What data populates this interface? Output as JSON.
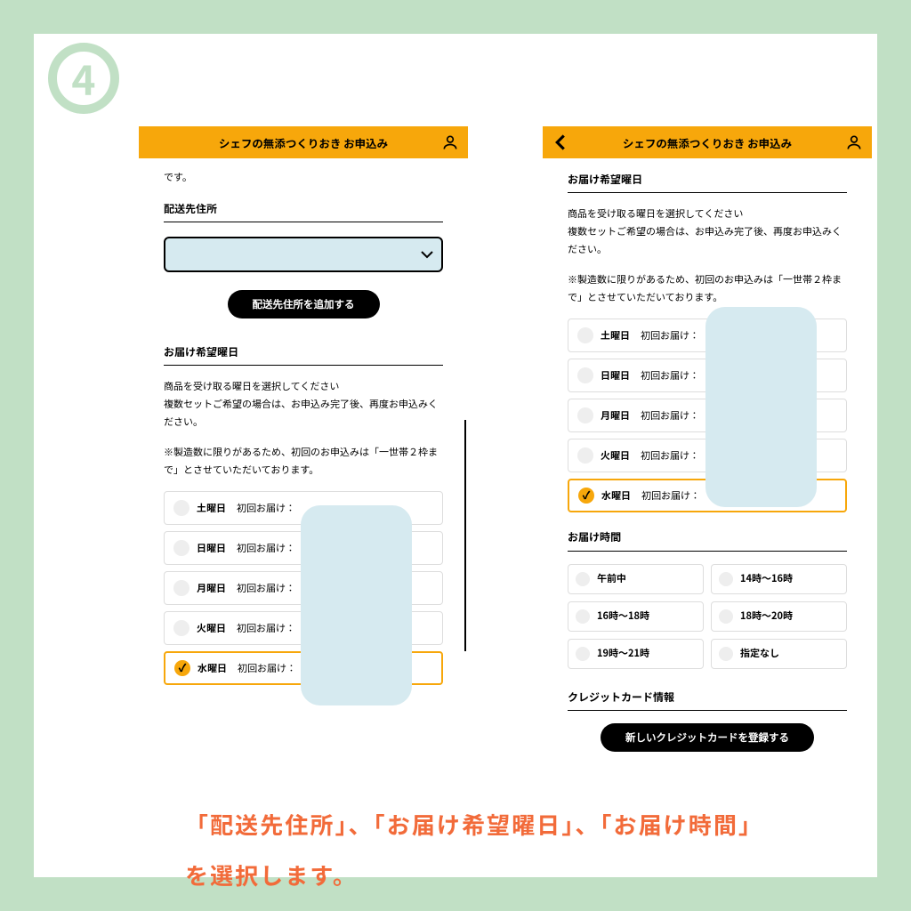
{
  "step_number": "4",
  "app_title": "シェフの無添つくりおき お申込み",
  "left_screen": {
    "trailing_text": "です。",
    "address_label": "配送先住所",
    "add_address_button": "配送先住所を追加する",
    "day_section_label": "お届け希望曜日",
    "day_help_1": "商品を受け取る曜日を選択してください",
    "day_help_2": "複数セットご希望の場合は、お申込み完了後、再度お申込みください。",
    "day_note": "※製造数に限りがあるため、初回のお申込みは「一世帯２枠まで」とさせていただいております。",
    "days": [
      {
        "name": "土曜日",
        "sub": "初回お届け：",
        "selected": false
      },
      {
        "name": "日曜日",
        "sub": "初回お届け：",
        "selected": false
      },
      {
        "name": "月曜日",
        "sub": "初回お届け：",
        "selected": false
      },
      {
        "name": "火曜日",
        "sub": "初回お届け：",
        "selected": false
      },
      {
        "name": "水曜日",
        "sub": "初回お届け：",
        "selected": true
      }
    ]
  },
  "right_screen": {
    "day_section_label": "お届け希望曜日",
    "day_help_1": "商品を受け取る曜日を選択してください",
    "day_help_2": "複数セットご希望の場合は、お申込み完了後、再度お申込みください。",
    "day_note": "※製造数に限りがあるため、初回のお申込みは「一世帯２枠まで」とさせていただいております。",
    "days": [
      {
        "name": "土曜日",
        "sub": "初回お届け：",
        "selected": false
      },
      {
        "name": "日曜日",
        "sub": "初回お届け：",
        "selected": false
      },
      {
        "name": "月曜日",
        "sub": "初回お届け：",
        "selected": false
      },
      {
        "name": "火曜日",
        "sub": "初回お届け：",
        "selected": false
      },
      {
        "name": "水曜日",
        "sub": "初回お届け：",
        "selected": true
      }
    ],
    "time_section_label": "お届け時間",
    "time_slots": [
      "午前中",
      "14時〜16時",
      "16時〜18時",
      "18時〜20時",
      "19時〜21時",
      "指定なし"
    ],
    "cc_section_label": "クレジットカード情報",
    "cc_button": "新しいクレジットカードを登録する"
  },
  "caption": "「配送先住所」、「お届け希望曜日」、「お届け時間」を選択します。"
}
